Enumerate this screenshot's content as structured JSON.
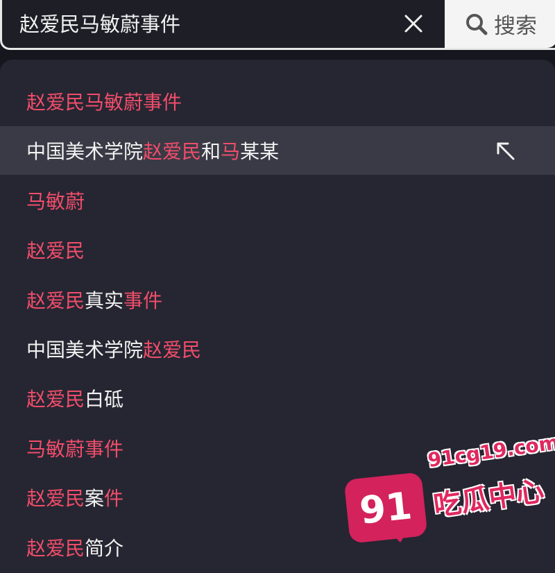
{
  "search": {
    "query": "赵爱民马敏蔚事件",
    "button_label": "搜索"
  },
  "suggestions": [
    {
      "segments": [
        {
          "text": "赵爱民马敏蔚事件",
          "hl": true
        }
      ]
    },
    {
      "segments": [
        {
          "text": "中国美术学院",
          "hl": false
        },
        {
          "text": "赵爱民",
          "hl": true
        },
        {
          "text": "和",
          "hl": false
        },
        {
          "text": "马",
          "hl": true
        },
        {
          "text": "某某",
          "hl": false
        }
      ],
      "highlighted": true
    },
    {
      "segments": [
        {
          "text": "马敏蔚",
          "hl": true
        }
      ]
    },
    {
      "segments": [
        {
          "text": "赵爱民",
          "hl": true
        }
      ]
    },
    {
      "segments": [
        {
          "text": "赵爱民",
          "hl": true
        },
        {
          "text": "真实",
          "hl": false
        },
        {
          "text": "事件",
          "hl": true
        }
      ]
    },
    {
      "segments": [
        {
          "text": "中国美术学院",
          "hl": false
        },
        {
          "text": "赵爱民",
          "hl": true
        }
      ]
    },
    {
      "segments": [
        {
          "text": "赵爱民",
          "hl": true
        },
        {
          "text": "白砥",
          "hl": false
        }
      ]
    },
    {
      "segments": [
        {
          "text": "马敏蔚事件",
          "hl": true
        }
      ]
    },
    {
      "segments": [
        {
          "text": "赵爱民",
          "hl": true
        },
        {
          "text": "案",
          "hl": false
        },
        {
          "text": "件",
          "hl": true
        }
      ]
    },
    {
      "segments": [
        {
          "text": "赵爱民",
          "hl": true
        },
        {
          "text": "简介",
          "hl": false
        }
      ]
    }
  ],
  "watermark": {
    "badge": "91",
    "domain": "91cg19.com",
    "name": "吃瓜中心"
  },
  "icons": {
    "clear": "close-icon",
    "search": "search-icon",
    "fill_suggestion": "arrow-up-left-icon"
  },
  "colors": {
    "highlight": "#f04d6a",
    "background": "#262632",
    "highlighted_row": "#3a3a46",
    "brand": "#d4225c"
  }
}
